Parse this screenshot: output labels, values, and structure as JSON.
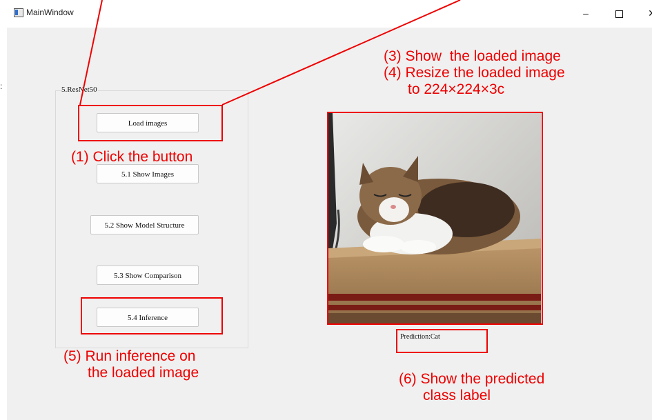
{
  "window": {
    "title": "MainWindow",
    "controls": {
      "minimize": "–",
      "close": "✕"
    }
  },
  "edge_fragment": ":",
  "group": {
    "title": "5.ResNet50"
  },
  "buttons": {
    "load": "Load images",
    "show_images": "5.1 Show Images",
    "model_structure": "5.2 Show Model Structure",
    "comparison": "5.3 Show Comparison",
    "inference": "5.4 Inference"
  },
  "prediction_label": "Prediction:Cat",
  "annotations": {
    "step1": "(1) Click the button",
    "step3_4": "(3) Show  the loaded image\n(4) Resize the loaded image\n      to 224×224×3c",
    "step5": "(5) Run inference on\n      the loaded image",
    "step6": "(6) Show the predicted\n      class label"
  },
  "colors": {
    "annotation": "#ee0000",
    "window_bg": "#f0f0f0"
  },
  "icons": [
    "app-window-icon",
    "minimize-icon",
    "maximize-icon",
    "close-icon",
    "cat-photo"
  ]
}
